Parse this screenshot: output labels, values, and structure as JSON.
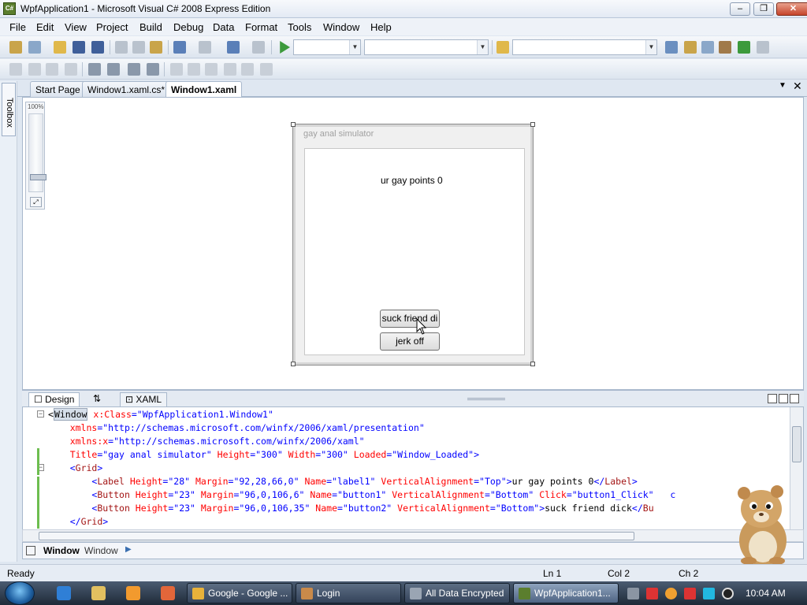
{
  "window": {
    "title": "WpfApplication1 - Microsoft Visual C# 2008 Express Edition",
    "icon_text": "C#",
    "minimize_glyph": "–",
    "maximize_glyph": "❐",
    "close_glyph": "✕"
  },
  "menu": [
    "File",
    "Edit",
    "View",
    "Project",
    "Build",
    "Debug",
    "Data",
    "Format",
    "Tools",
    "Window",
    "Help"
  ],
  "toolbox": {
    "label": "Toolbox"
  },
  "doc_tabs": [
    {
      "label": "Start Page",
      "active": false
    },
    {
      "label": "Window1.xaml.cs*",
      "active": false
    },
    {
      "label": "Window1.xaml",
      "active": true
    }
  ],
  "zoom": {
    "label": "100%",
    "fit_glyph": "⤢",
    "level": 1.0
  },
  "designer": {
    "window_title": "gay anal simulator",
    "label_text": "ur gay points 0",
    "button1_text": "suck friend di",
    "button2_text": "jerk off"
  },
  "split_tabs": {
    "design": "Design",
    "swap": "⇅",
    "xaml": "XAML"
  },
  "code_lines": [
    {
      "indent": "",
      "parts": [
        [
          "t",
          "<"
        ],
        [
          "sel",
          "Window"
        ],
        [
          "a",
          " x:Class"
        ],
        [
          "v",
          "=\"WpfApplication1.Window1\""
        ]
      ]
    },
    {
      "indent": "    ",
      "parts": [
        [
          "a",
          "xmlns"
        ],
        [
          "v",
          "=\"http://schemas.microsoft.com/winfx/2006/xaml/presentation\""
        ]
      ]
    },
    {
      "indent": "    ",
      "parts": [
        [
          "a",
          "xmlns:x"
        ],
        [
          "v",
          "=\"http://schemas.microsoft.com/winfx/2006/xaml\""
        ]
      ]
    },
    {
      "indent": "    ",
      "parts": [
        [
          "a",
          "Title"
        ],
        [
          "v",
          "=\"gay anal simulator\""
        ],
        [
          "a",
          " Height"
        ],
        [
          "v",
          "=\"300\""
        ],
        [
          "a",
          " Width"
        ],
        [
          "v",
          "=\"300\""
        ],
        [
          "a",
          " Loaded"
        ],
        [
          "v",
          "=\"Window_Loaded\""
        ],
        [
          "v",
          ">"
        ]
      ]
    },
    {
      "indent": "    ",
      "parts": [
        [
          "v",
          "<"
        ],
        [
          "k",
          "Grid"
        ],
        [
          "v",
          ">"
        ]
      ]
    },
    {
      "indent": "        ",
      "parts": [
        [
          "v",
          "<"
        ],
        [
          "k",
          "Label"
        ],
        [
          "a",
          " Height"
        ],
        [
          "v",
          "=\"28\""
        ],
        [
          "a",
          " Margin"
        ],
        [
          "v",
          "=\"92,28,66,0\""
        ],
        [
          "a",
          " Name"
        ],
        [
          "v",
          "=\"label1\""
        ],
        [
          "a",
          " VerticalAlignment"
        ],
        [
          "v",
          "=\"Top\""
        ],
        [
          "v",
          ">"
        ],
        [
          "t",
          "ur gay points 0"
        ],
        [
          "v",
          "</"
        ],
        [
          "k",
          "Label"
        ],
        [
          "v",
          ">"
        ]
      ]
    },
    {
      "indent": "        ",
      "parts": [
        [
          "v",
          "<"
        ],
        [
          "k",
          "Button"
        ],
        [
          "a",
          " Height"
        ],
        [
          "v",
          "=\"23\""
        ],
        [
          "a",
          " Margin"
        ],
        [
          "v",
          "=\"96,0,106,6\""
        ],
        [
          "a",
          " Name"
        ],
        [
          "v",
          "=\"button1\""
        ],
        [
          "a",
          " VerticalAlignment"
        ],
        [
          "v",
          "=\"Bottom\""
        ],
        [
          "a",
          " Click"
        ],
        [
          "v",
          "=\"button1_Click\""
        ],
        [
          "t",
          "   "
        ],
        [
          "v",
          "c"
        ]
      ]
    },
    {
      "indent": "        ",
      "parts": [
        [
          "v",
          "<"
        ],
        [
          "k",
          "Button"
        ],
        [
          "a",
          " Height"
        ],
        [
          "v",
          "=\"23\""
        ],
        [
          "a",
          " Margin"
        ],
        [
          "v",
          "=\"96,0,106,35\""
        ],
        [
          "a",
          " Name"
        ],
        [
          "v",
          "=\"button2\""
        ],
        [
          "a",
          " VerticalAlignment"
        ],
        [
          "v",
          "=\"Bottom\""
        ],
        [
          "v",
          ">"
        ],
        [
          "t",
          "suck friend dick"
        ],
        [
          "v",
          "</"
        ],
        [
          "k",
          "Bu"
        ]
      ]
    },
    {
      "indent": "    ",
      "parts": [
        [
          "v",
          "</"
        ],
        [
          "k",
          "Grid"
        ],
        [
          "v",
          ">"
        ]
      ]
    }
  ],
  "element_path": {
    "first": "Window",
    "second": "Window",
    "arrow": "▶"
  },
  "status": {
    "ready": "Ready",
    "line": "Ln 1",
    "col": "Col 2",
    "ch": "Ch 2"
  },
  "taskbar": {
    "buttons": [
      {
        "label": "Google - Google ...",
        "color": "#e8b23a",
        "active": false
      },
      {
        "label": "Login",
        "color": "#c98a4a",
        "active": false
      },
      {
        "label": "All Data Encrypted",
        "color": "#9aa5b3",
        "active": false
      },
      {
        "label": "WpfApplication1...",
        "color": "#5b7e2e",
        "active": true
      }
    ],
    "clock": "10:04 AM"
  }
}
